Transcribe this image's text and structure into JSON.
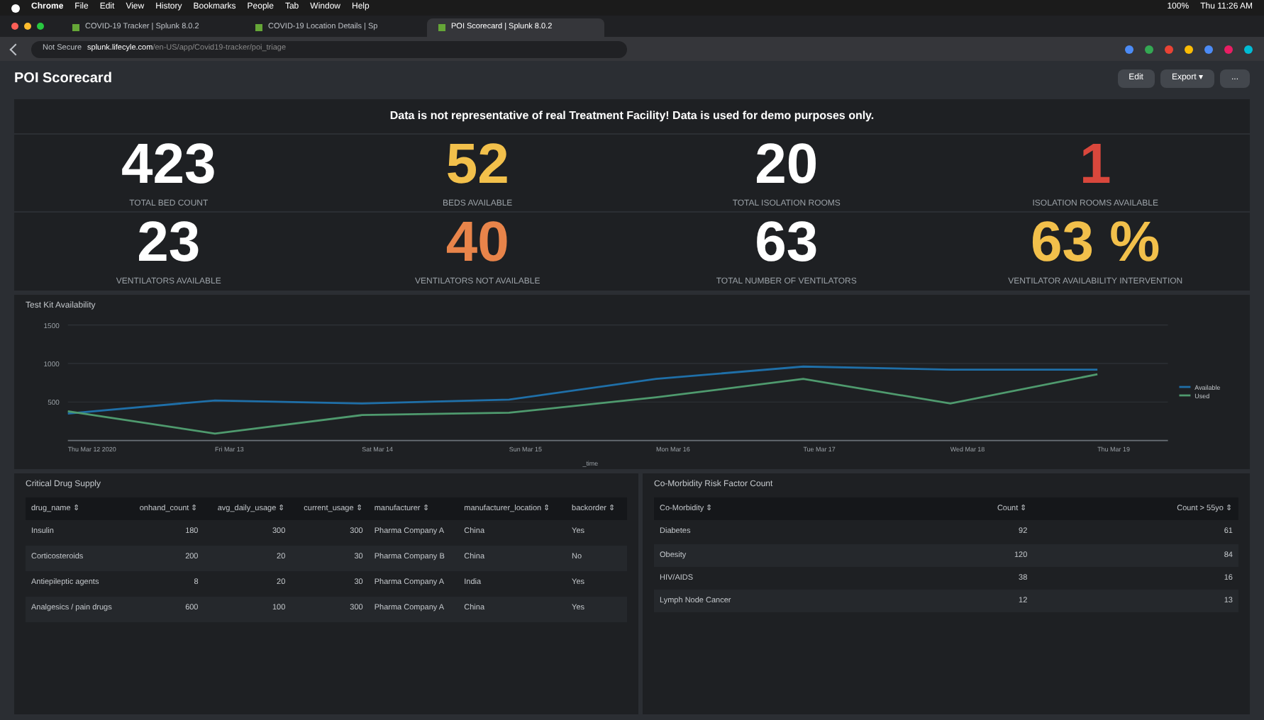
{
  "menu_bar": {
    "items": [
      "Chrome",
      "File",
      "Edit",
      "View",
      "History",
      "Bookmarks",
      "People",
      "Tab",
      "Window",
      "Help"
    ],
    "battery": "100%",
    "clock": "Thu 11:26 AM"
  },
  "tabs": [
    {
      "label": "COVID-19 Tracker | Splunk 8.0.2",
      "selected": false
    },
    {
      "label": "COVID-19 Location Details | Sp",
      "selected": false
    },
    {
      "label": "POI Scorecard | Splunk 8.0.2",
      "selected": true
    }
  ],
  "address_bar": {
    "security": "Not Secure",
    "url": "splunk.lifecyle.com",
    "path": "/en-US/app/Covid19-tracker/poi_triage"
  },
  "dashboard": {
    "title": "POI Scorecard",
    "buttons": [
      "Edit",
      "Export ▾",
      "..."
    ],
    "banner": "Data is not representative of real Treatment Facility! Data is used for demo purposes only.",
    "kpis": [
      {
        "value": "423",
        "label": "TOTAL BED COUNT",
        "color": "#ffffff"
      },
      {
        "value": "52",
        "label": "BEDS AVAILABLE",
        "color": "#f2c04b"
      },
      {
        "value": "20",
        "label": "TOTAL ISOLATION ROOMS",
        "color": "#ffffff"
      },
      {
        "value": "1",
        "label": "ISOLATION ROOMS AVAILABLE",
        "color": "#d9473c"
      },
      {
        "value": "23",
        "label": "VENTILATORS AVAILABLE",
        "color": "#ffffff"
      },
      {
        "value": "40",
        "label": "VENTILATORS NOT AVAILABLE",
        "color": "#e8844a"
      },
      {
        "value": "63",
        "label": "TOTAL NUMBER OF VENTILATORS",
        "color": "#ffffff"
      },
      {
        "value": "63 %",
        "label": "VENTILATOR AVAILABILITY INTERVENTION",
        "color": "#f2c04b"
      }
    ],
    "chart_panel": {
      "title": "Test Kit Availability",
      "chart_data": {
        "type": "line",
        "xlabel": "_time",
        "categories": [
          "Thu Mar 12 2020",
          "Fri Mar 13",
          "Sat Mar 14",
          "Sun Mar 15",
          "Mon Mar 16",
          "Tue Mar 17",
          "Wed Mar 18",
          "Thu Mar 19"
        ],
        "series": [
          {
            "name": "Available",
            "color": "#1f6fa8",
            "values": [
              350,
              520,
              480,
              530,
              800,
              960,
              920,
              920
            ]
          },
          {
            "name": "Used",
            "color": "#4f9a6e",
            "values": [
              380,
              90,
              330,
              360,
              560,
              800,
              480,
              860
            ]
          }
        ],
        "ylim": [
          0,
          1500
        ],
        "yticks": [
          500,
          1000,
          1500
        ],
        "legend": "right"
      }
    },
    "drug_table": {
      "title": "Critical Drug Supply",
      "columns": [
        "drug_name ⇕",
        "onhand_count ⇕",
        "avg_daily_usage ⇕",
        "current_usage ⇕",
        "manufacturer ⇕",
        "manufacturer_location ⇕",
        "backorder ⇕"
      ],
      "rows": [
        [
          "Insulin",
          "180",
          "300",
          "300",
          "Pharma Company A",
          "China",
          "Yes"
        ],
        [
          "Corticosteroids",
          "200",
          "20",
          "30",
          "Pharma Company B",
          "China",
          "No"
        ],
        [
          "Antiepileptic agents",
          "8",
          "20",
          "30",
          "Pharma Company A",
          "India",
          "Yes"
        ],
        [
          "Analgesics / pain drugs",
          "600",
          "100",
          "300",
          "Pharma Company A",
          "China",
          "Yes"
        ]
      ]
    },
    "comorbidity_table": {
      "title": "Co-Morbidity Risk Factor Count",
      "columns": [
        "Co-Morbidity ⇕",
        "Count ⇕",
        "Count > 55yo ⇕"
      ],
      "rows": [
        [
          "Diabetes",
          "92",
          "61"
        ],
        [
          "Obesity",
          "120",
          "84"
        ],
        [
          "HIV/AIDS",
          "38",
          "16"
        ],
        [
          "Lymph Node Cancer",
          "12",
          "13"
        ]
      ]
    }
  }
}
